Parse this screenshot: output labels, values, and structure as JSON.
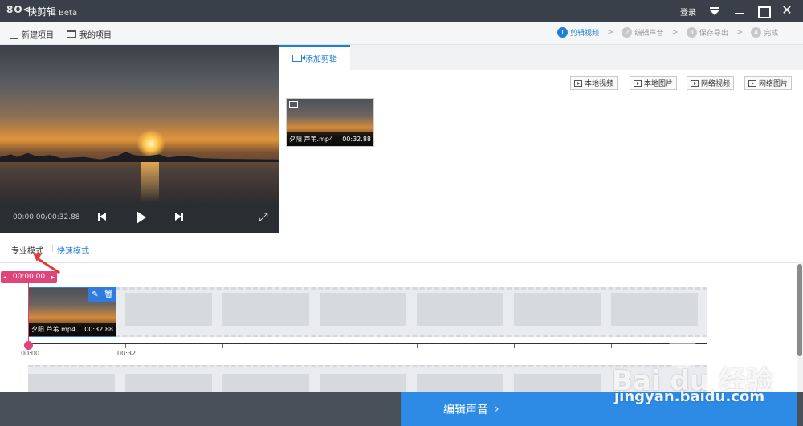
{
  "titlebar": {
    "logo": "8O<",
    "app_name": "快剪辑",
    "beta": "Beta",
    "login": "登录",
    "close_glyph": "✕"
  },
  "toolbar": {
    "new_project": "新建项目",
    "my_projects": "我的项目",
    "steps": [
      {
        "num": "1",
        "label": "剪辑视频",
        "active": true
      },
      {
        "num": "2",
        "label": "编辑声音",
        "active": false
      },
      {
        "num": "3",
        "label": "保存导出",
        "active": false
      },
      {
        "num": "4",
        "label": "完成",
        "active": false
      }
    ],
    "separator": ">"
  },
  "player": {
    "timecode": "00:00.00/00:32.88",
    "fullscreen_glyph": "⤢"
  },
  "media_panel": {
    "tab_label": "添加剪辑",
    "source_buttons": [
      "本地视频",
      "本地图片",
      "网络视频",
      "网络图片"
    ],
    "clip": {
      "filename": "夕阳 芦苇.mp4",
      "duration": "00:32.88"
    }
  },
  "modes": {
    "pro": "专业模式",
    "separator": "|",
    "fast": "快速模式"
  },
  "timeline": {
    "playhead_time": "00:00.00",
    "clip": {
      "filename": "夕阳 芦苇.mp4",
      "duration": "00:32.88"
    },
    "edit_glyph": "✎",
    "delete_glyph": "🗑",
    "ruler_labels": [
      "00:00",
      "00:32"
    ]
  },
  "footer": {
    "next_label": "编辑声音",
    "chevron": "›"
  },
  "watermark": {
    "logo": "Bai du 经验",
    "url": "jingyan.baidu.com"
  },
  "colors": {
    "accent": "#1e7fd6",
    "playhead": "#e0457a",
    "titlebar": "#3a4049",
    "primary_button": "#2d8be6",
    "annotation_arrow": "#e23b3b"
  }
}
